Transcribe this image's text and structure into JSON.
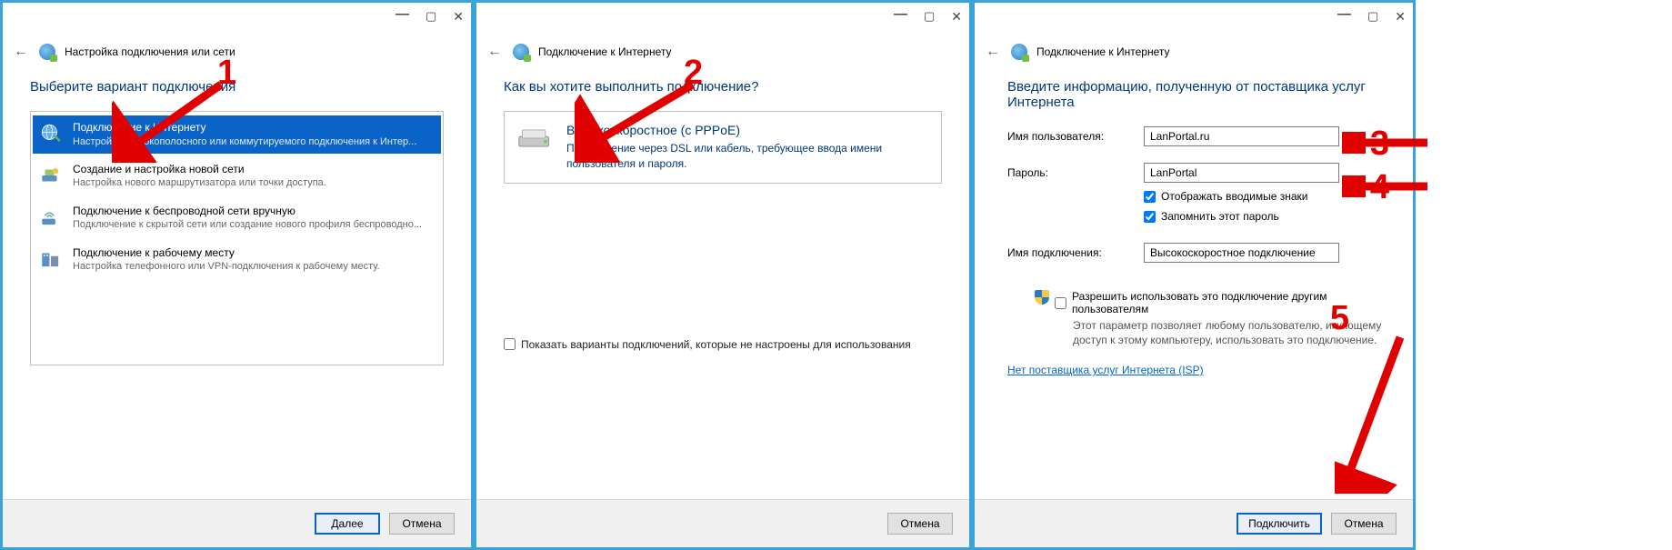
{
  "win1": {
    "title": "Настройка подключения или сети",
    "heading": "Выберите вариант подключения",
    "options": [
      {
        "title": "Подключение к Интернету",
        "sub": "Настройка широкополосного или коммутируемого подключения к Интер..."
      },
      {
        "title": "Создание и настройка новой сети",
        "sub": "Настройка нового маршрутизатора или точки доступа."
      },
      {
        "title": "Подключение к беспроводной сети вручную",
        "sub": "Подключение к скрытой сети или создание нового профиля беспроводно..."
      },
      {
        "title": "Подключение к рабочему месту",
        "sub": "Настройка телефонного или VPN-подключения к рабочему месту."
      }
    ],
    "next": "Далее",
    "cancel": "Отмена"
  },
  "win2": {
    "title": "Подключение к Интернету",
    "heading": "Как вы хотите выполнить подключение?",
    "option": {
      "title": "Высокоскоростное (с PPPoE)",
      "sub": "Подключение через DSL или кабель, требующее ввода имени пользователя и пароля."
    },
    "show_unconfigured": "Показать варианты подключений, которые не настроены для использования",
    "cancel": "Отмена"
  },
  "win3": {
    "title": "Подключение к Интернету",
    "heading": "Введите информацию, полученную от поставщика услуг Интернета",
    "labels": {
      "user": "Имя пользователя:",
      "pass": "Пароль:",
      "conn": "Имя подключения:"
    },
    "values": {
      "user": "LanPortal.ru",
      "pass": "LanPortal",
      "conn": "Высокоскоростное подключение"
    },
    "show_chars": "Отображать вводимые знаки",
    "remember": "Запомнить этот пароль",
    "allow_others": "Разрешить использовать это подключение другим пользователям",
    "allow_sub": "Этот параметр позволяет любому пользователю, имеющему доступ к этому компьютеру, использовать это подключение.",
    "no_isp": "Нет поставщика услуг Интернета (ISP)",
    "connect": "Подключить",
    "cancel": "Отмена"
  },
  "anno": {
    "n1": "1",
    "n2": "2",
    "n3": "3",
    "n4": "4",
    "n5": "5"
  }
}
